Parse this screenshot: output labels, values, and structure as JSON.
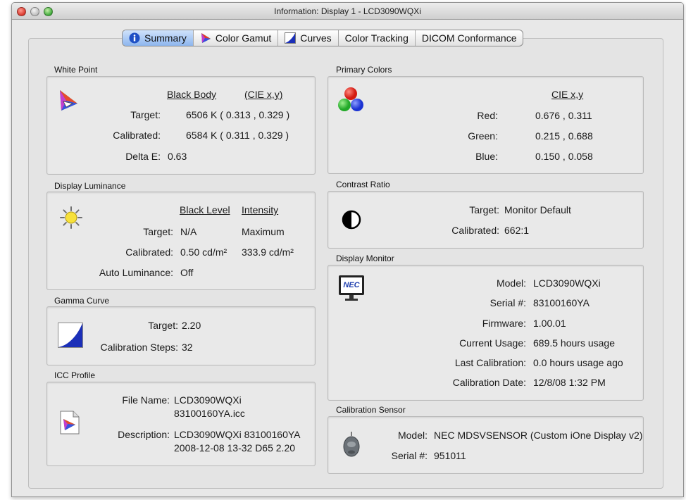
{
  "window": {
    "title": "Information: Display 1 - LCD3090WQXi"
  },
  "tabs": [
    {
      "label": "Summary",
      "icon": "info-icon"
    },
    {
      "label": "Color Gamut",
      "icon": "color-gamut-icon"
    },
    {
      "label": "Curves",
      "icon": "curves-icon"
    },
    {
      "label": "Color Tracking"
    },
    {
      "label": "DICOM Conformance"
    }
  ],
  "white_point": {
    "label": "White Point",
    "col1": "Black Body",
    "col2": "(CIE x,y)",
    "target_label": "Target:",
    "target_value": "6506 K  ( 0.313 , 0.329 )",
    "calibrated_label": "Calibrated:",
    "calibrated_value": "6584 K  ( 0.311 , 0.329 )",
    "delta_label": "Delta E:",
    "delta_value": "0.63"
  },
  "display_luminance": {
    "label": "Display Luminance",
    "col1": "Black Level",
    "col2": "Intensity",
    "target_label": "Target:",
    "target_black": "N/A",
    "target_intensity": "Maximum",
    "calibrated_label": "Calibrated:",
    "calibrated_black": "0.50 cd/m²",
    "calibrated_intensity": "333.9 cd/m²",
    "auto_label": "Auto Luminance:",
    "auto_value": "Off"
  },
  "gamma_curve": {
    "label": "Gamma Curve",
    "target_label": "Target:",
    "target_value": "2.20",
    "steps_label": "Calibration Steps:",
    "steps_value": "32"
  },
  "icc_profile": {
    "label": "ICC Profile",
    "file_label": "File Name:",
    "file_line1": "LCD3090WQXi",
    "file_line2": "83100160YA.icc",
    "desc_label": "Description:",
    "desc_line1": "LCD3090WQXi 83100160YA",
    "desc_line2": "2008-12-08 13-32 D65 2.20"
  },
  "primary_colors": {
    "label": "Primary Colors",
    "col": "CIE x,y",
    "red_label": "Red:",
    "red_value": "0.676 , 0.311",
    "green_label": "Green:",
    "green_value": "0.215 , 0.688",
    "blue_label": "Blue:",
    "blue_value": "0.150 , 0.058"
  },
  "contrast_ratio": {
    "label": "Contrast Ratio",
    "target_label": "Target:",
    "target_value": "Monitor Default",
    "calibrated_label": "Calibrated:",
    "calibrated_value": "662:1"
  },
  "display_monitor": {
    "label": "Display Monitor",
    "monitor_brand": "NEC",
    "rows": [
      {
        "label": "Model:",
        "value": "LCD3090WQXi"
      },
      {
        "label": "Serial #:",
        "value": "83100160YA"
      },
      {
        "label": "Firmware:",
        "value": "1.00.01"
      },
      {
        "label": "Current Usage:",
        "value": "689.5 hours usage"
      },
      {
        "label": "Last Calibration:",
        "value": "0.0 hours usage ago"
      },
      {
        "label": "Calibration Date:",
        "value": "12/8/08 1:32 PM"
      }
    ]
  },
  "calibration_sensor": {
    "label": "Calibration Sensor",
    "model_label": "Model:",
    "model_value": "NEC MDSVSENSOR (Custom iOne Display v2)",
    "serial_label": "Serial #:",
    "serial_value": "951011"
  },
  "colors": {
    "tab_active": "#8db6ee",
    "info_blue": "#1d4fc4",
    "nec_blue": "#1f3fae",
    "close_red": "#d9372c",
    "zoom_green": "#3ea83a"
  }
}
